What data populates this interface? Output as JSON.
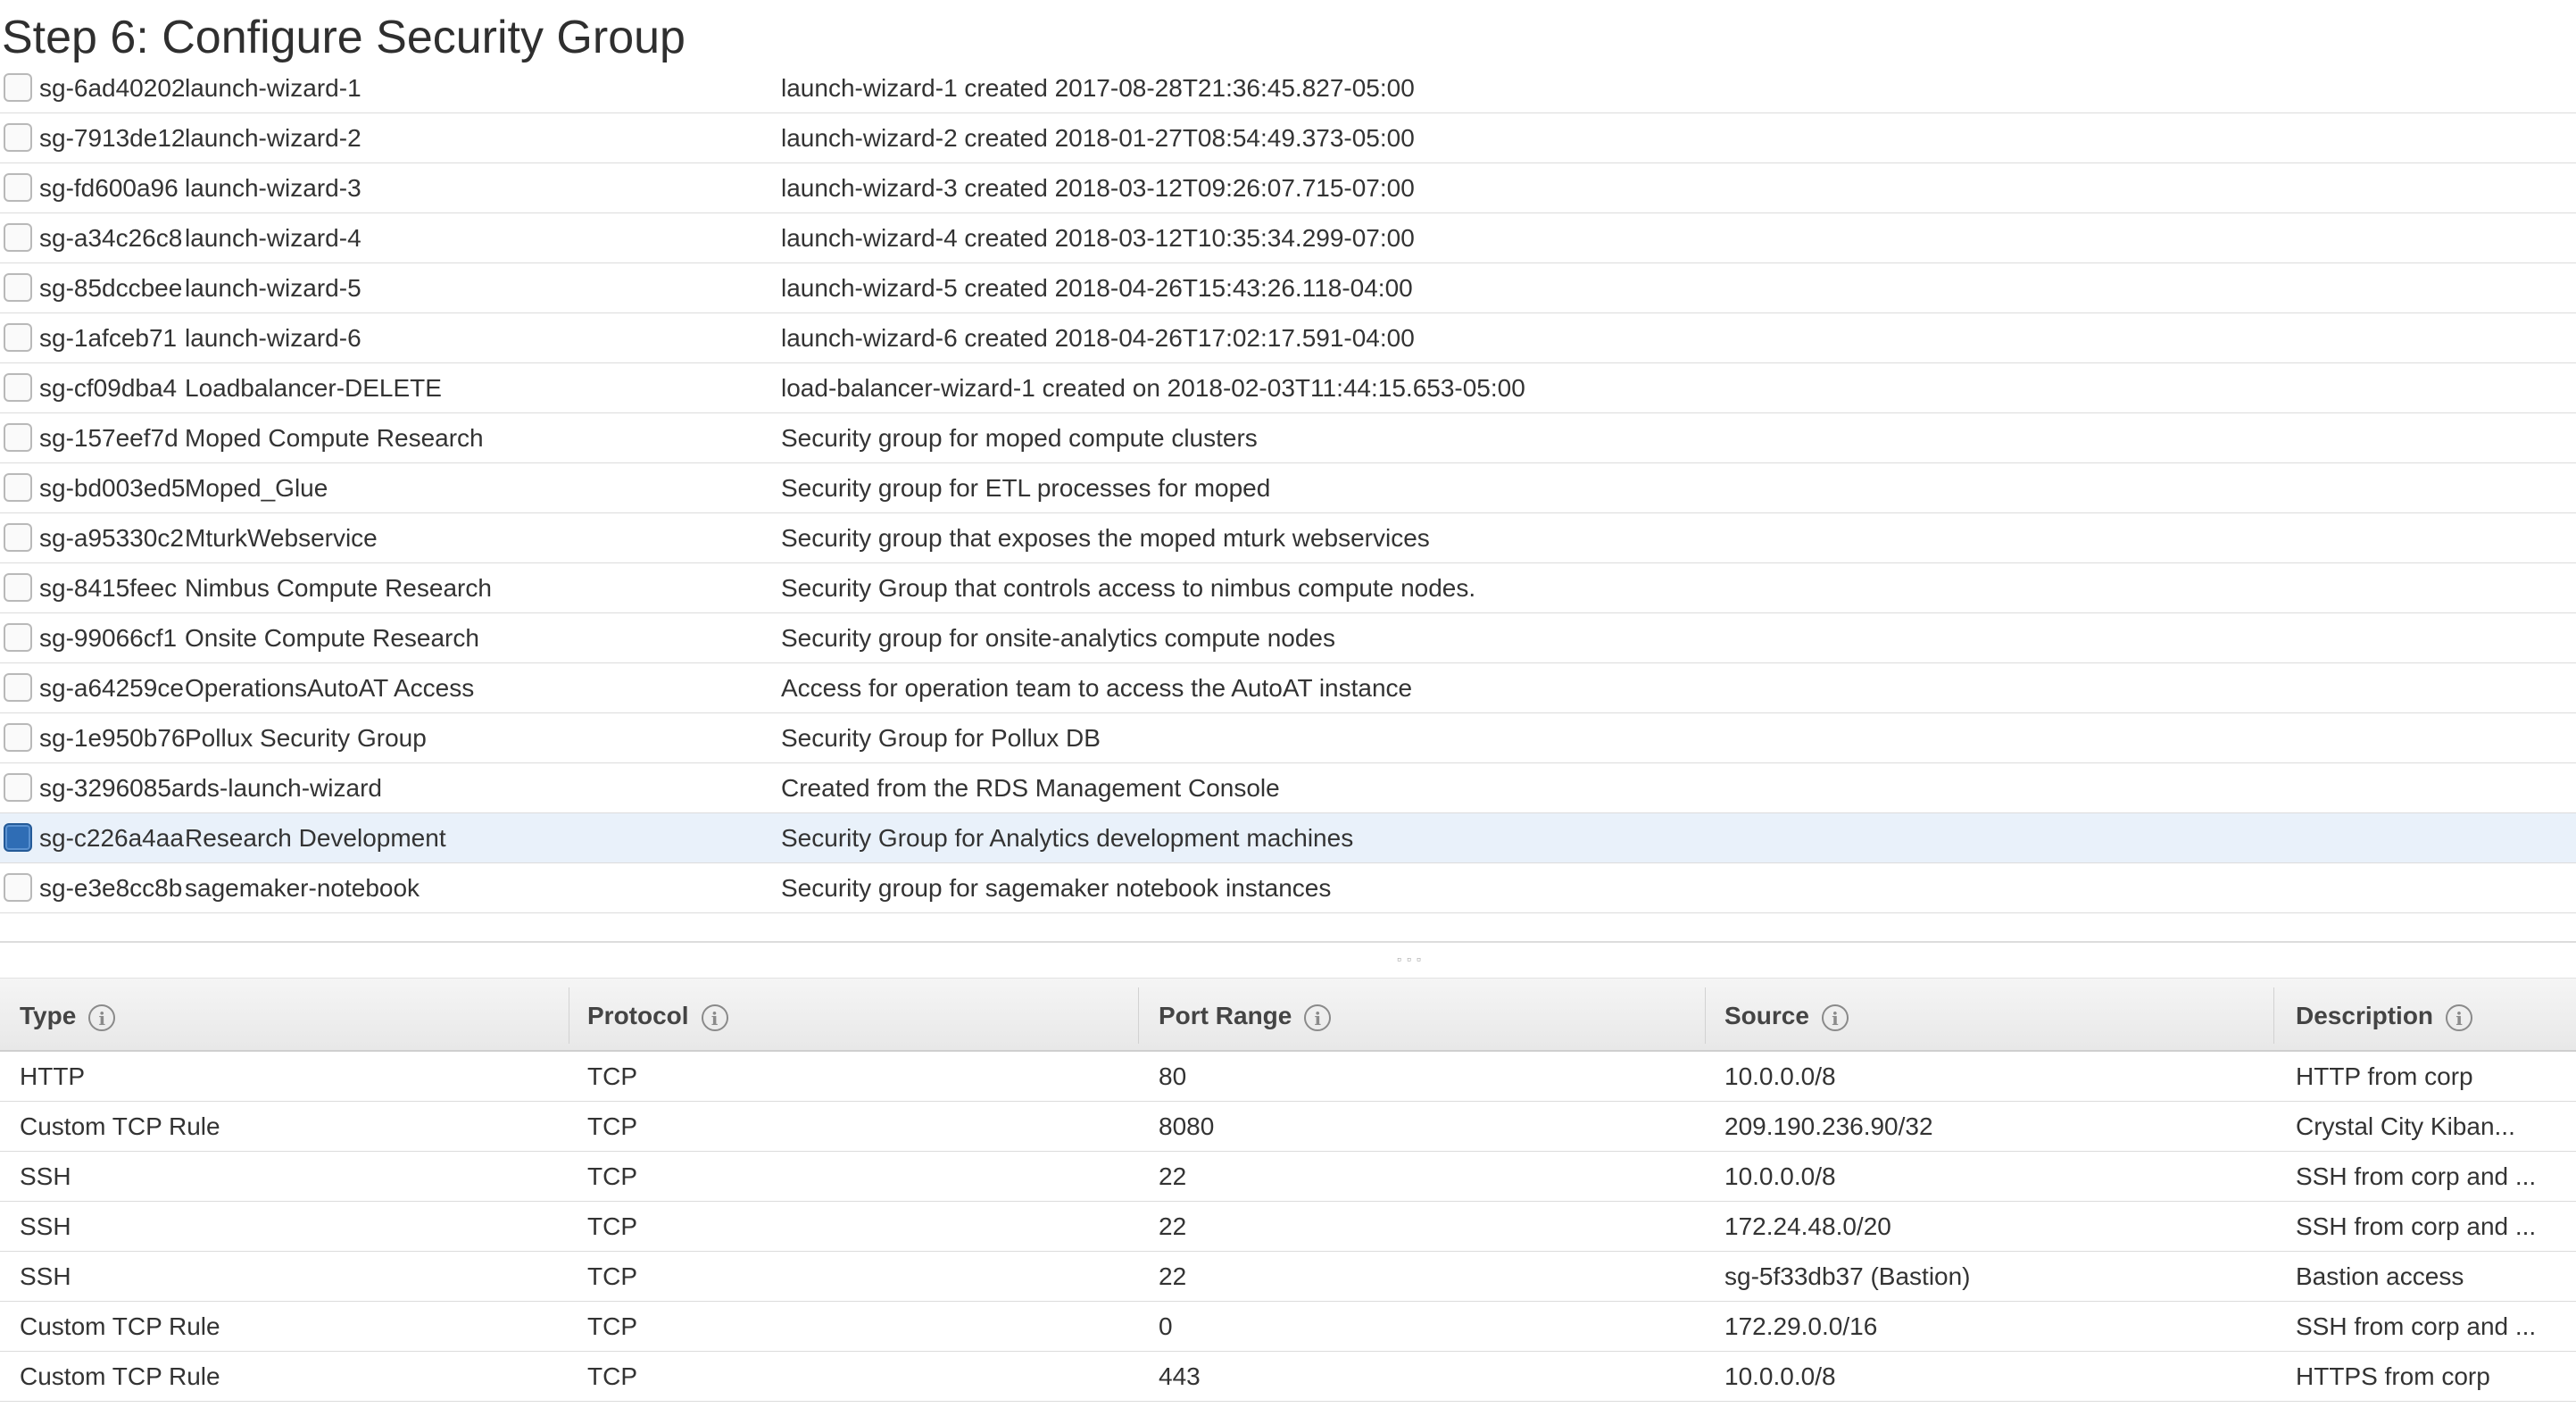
{
  "page": {
    "title": "Step 6: Configure Security Group"
  },
  "security_groups": [
    {
      "id": "sg-6ad40202",
      "name": "launch-wizard-1",
      "description": "launch-wizard-1 created 2017-08-28T21:36:45.827-05:00",
      "selected": false
    },
    {
      "id": "sg-7913de12",
      "name": "launch-wizard-2",
      "description": "launch-wizard-2 created 2018-01-27T08:54:49.373-05:00",
      "selected": false
    },
    {
      "id": "sg-fd600a96",
      "name": "launch-wizard-3",
      "description": "launch-wizard-3 created 2018-03-12T09:26:07.715-07:00",
      "selected": false
    },
    {
      "id": "sg-a34c26c8",
      "name": "launch-wizard-4",
      "description": "launch-wizard-4 created 2018-03-12T10:35:34.299-07:00",
      "selected": false
    },
    {
      "id": "sg-85dccbee",
      "name": "launch-wizard-5",
      "description": "launch-wizard-5 created 2018-04-26T15:43:26.118-04:00",
      "selected": false
    },
    {
      "id": "sg-1afceb71",
      "name": "launch-wizard-6",
      "description": "launch-wizard-6 created 2018-04-26T17:02:17.591-04:00",
      "selected": false
    },
    {
      "id": "sg-cf09dba4",
      "name": "Loadbalancer-DELETE",
      "description": "load-balancer-wizard-1 created on 2018-02-03T11:44:15.653-05:00",
      "selected": false
    },
    {
      "id": "sg-157eef7d",
      "name": "Moped Compute Research",
      "description": "Security group for moped compute clusters",
      "selected": false
    },
    {
      "id": "sg-bd003ed5",
      "name": "Moped_Glue",
      "description": "Security group for ETL processes for moped",
      "selected": false
    },
    {
      "id": "sg-a95330c2",
      "name": "MturkWebservice",
      "description": "Security group that exposes the moped mturk webservices",
      "selected": false
    },
    {
      "id": "sg-8415feec",
      "name": "Nimbus Compute Research",
      "description": "Security Group that controls access to nimbus compute nodes.",
      "selected": false
    },
    {
      "id": "sg-99066cf1",
      "name": "Onsite Compute Research",
      "description": "Security group for onsite-analytics compute nodes",
      "selected": false
    },
    {
      "id": "sg-a64259ce",
      "name": "OperationsAutoAT Access",
      "description": "Access for operation team to access the AutoAT instance",
      "selected": false
    },
    {
      "id": "sg-1e950b76",
      "name": "Pollux Security Group",
      "description": "Security Group for Pollux DB",
      "selected": false
    },
    {
      "id": "sg-3296085a",
      "name": "rds-launch-wizard",
      "description": "Created from the RDS Management Console",
      "selected": false
    },
    {
      "id": "sg-c226a4aa",
      "name": "Research Development",
      "description": "Security Group for Analytics development machines",
      "selected": true
    },
    {
      "id": "sg-e3e8cc8b",
      "name": "sagemaker-notebook",
      "description": "Security group for sagemaker notebook instances",
      "selected": false
    }
  ],
  "rules_table": {
    "columns": [
      "Type",
      "Protocol",
      "Port Range",
      "Source",
      "Description"
    ],
    "rows": [
      [
        "HTTP",
        "TCP",
        "80",
        "10.0.0.0/8",
        "HTTP from corp"
      ],
      [
        "Custom TCP Rule",
        "TCP",
        "8080",
        "209.190.236.90/32",
        "Crystal City Kiban..."
      ],
      [
        "SSH",
        "TCP",
        "22",
        "10.0.0.0/8",
        "SSH from corp and ..."
      ],
      [
        "SSH",
        "TCP",
        "22",
        "172.24.48.0/20",
        "SSH from corp and ..."
      ],
      [
        "SSH",
        "TCP",
        "22",
        "sg-5f33db37 (Bastion)",
        "Bastion access"
      ],
      [
        "Custom TCP Rule",
        "TCP",
        "0",
        "172.29.0.0/16",
        "SSH from corp and ..."
      ],
      [
        "Custom TCP Rule",
        "TCP",
        "443",
        "10.0.0.0/8",
        "HTTPS from corp"
      ]
    ]
  },
  "colors": {
    "selected_row": "#e9f1fa",
    "checkbox_checked": "#2f6db5"
  },
  "icons": {
    "info": "info-icon",
    "splitter": "drag-handle-icon"
  }
}
